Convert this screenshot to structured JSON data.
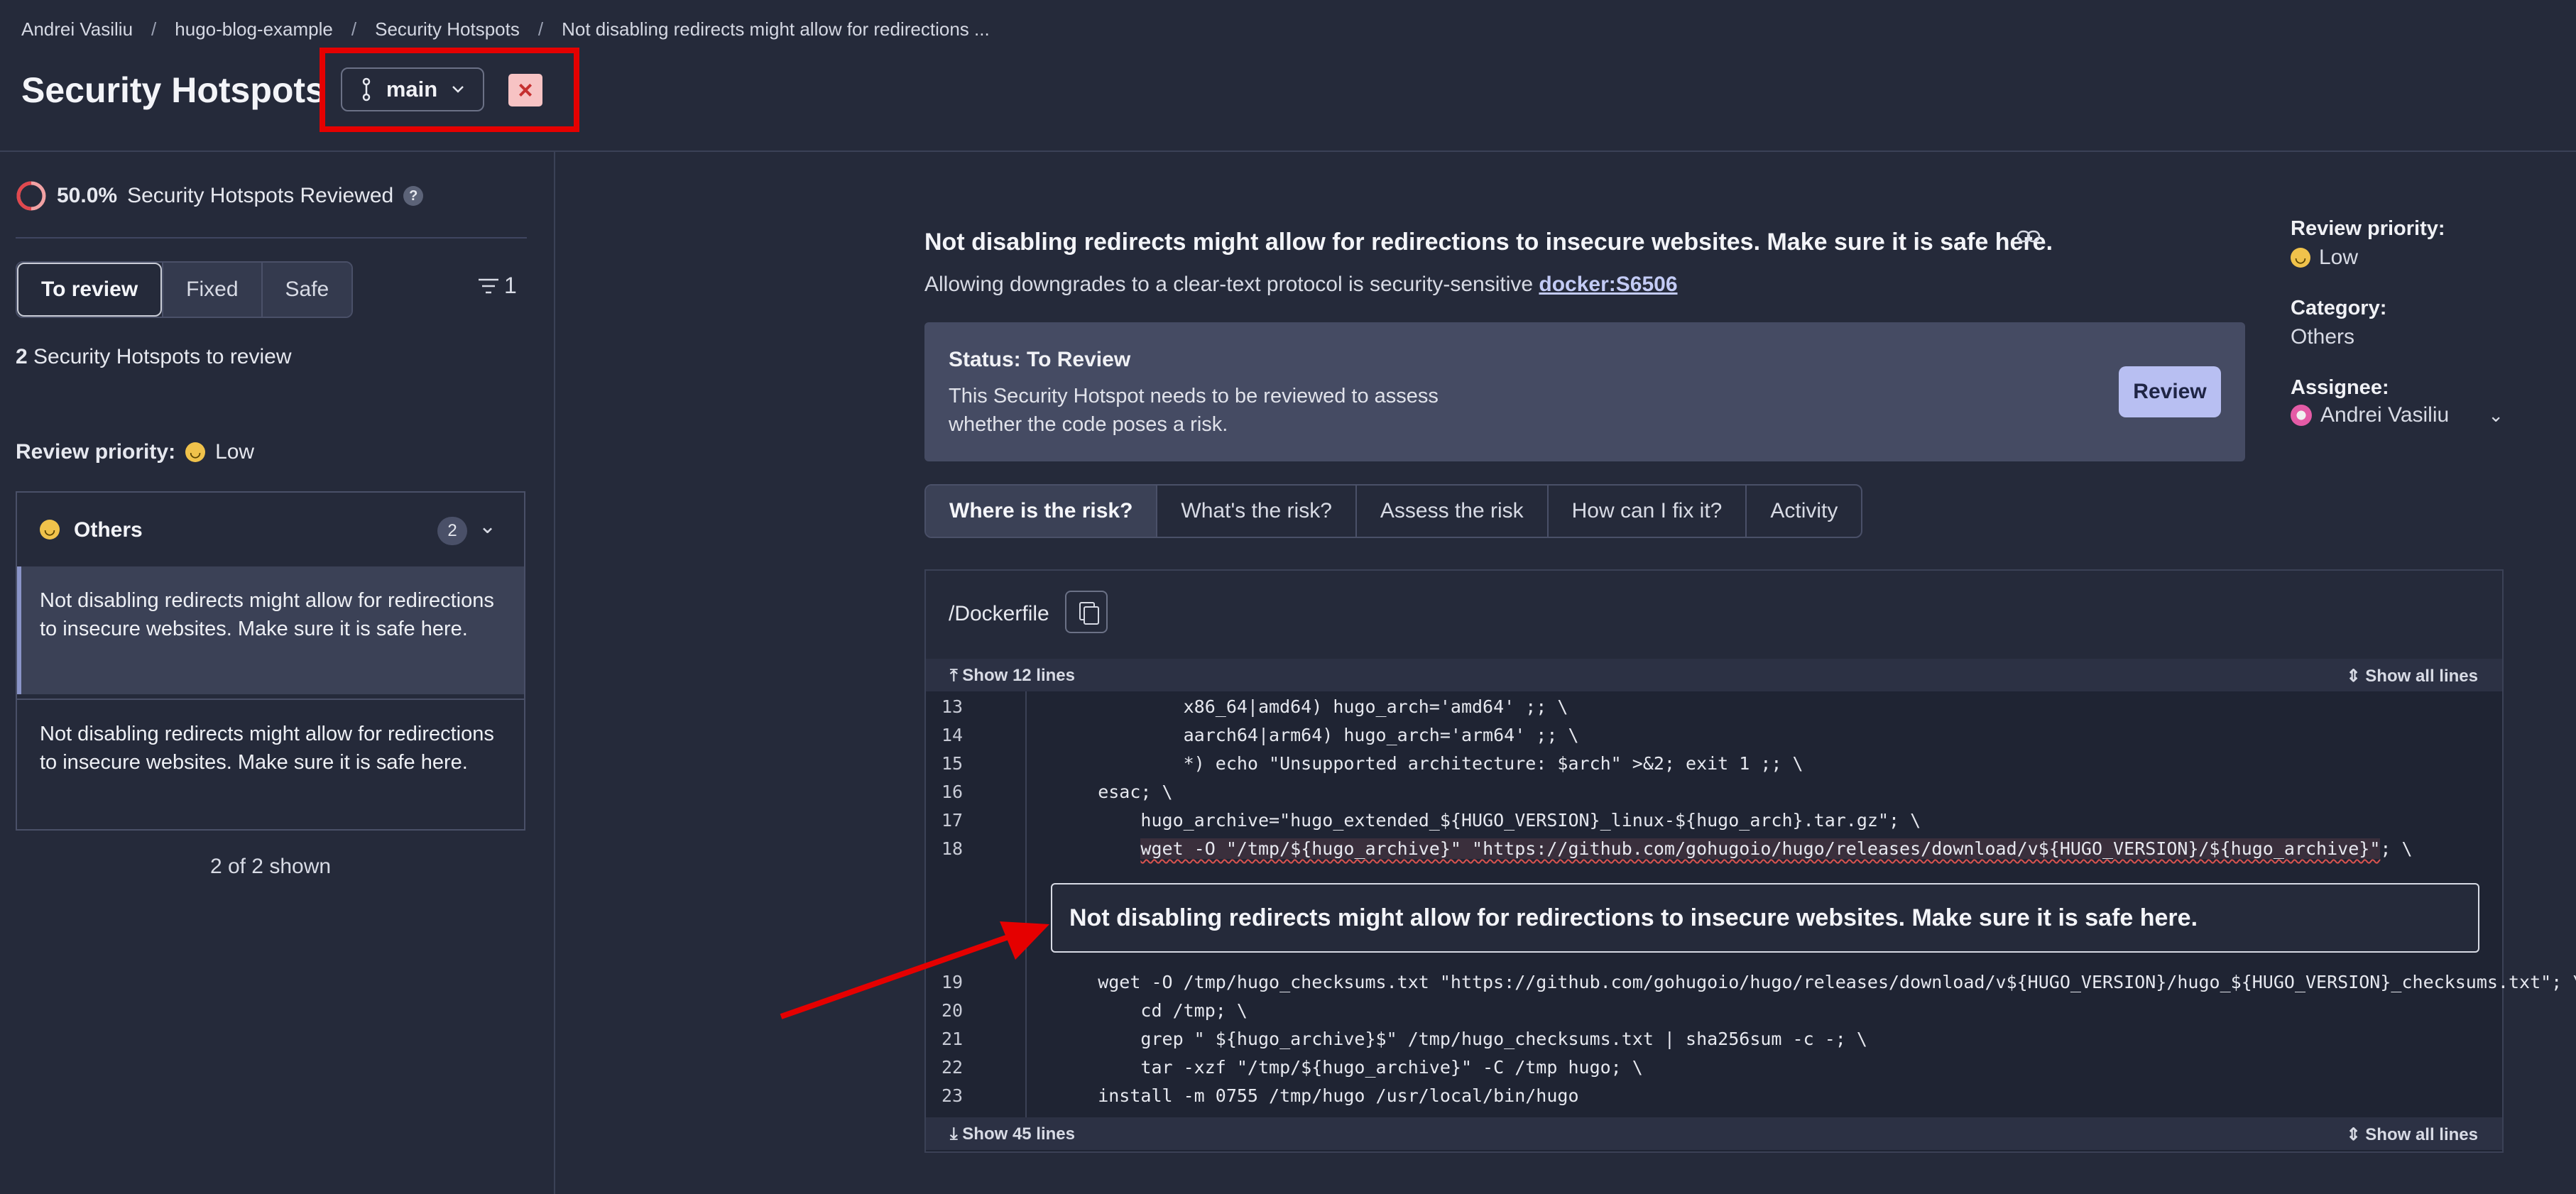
{
  "breadcrumb": {
    "items": [
      "Andrei Vasiliu",
      "hugo-blog-example",
      "Security Hotspots",
      "Not disabling redirects might allow for redirections ..."
    ],
    "separator": "/"
  },
  "header": {
    "title": "Security Hotspots",
    "branch": "main",
    "close_symbol": "×"
  },
  "sidebar": {
    "progress_percent": "50.0%",
    "progress_fraction": 0.5,
    "progress_label": "Security Hotspots Reviewed",
    "help_symbol": "?",
    "tabs": [
      "To review",
      "Fixed",
      "Safe"
    ],
    "filter_count": "1",
    "hotspot_count": "2",
    "hotspot_count_label": "Security Hotspots to review",
    "review_priority_label": "Review priority:",
    "review_priority_value": "Low",
    "category": {
      "name": "Others",
      "count": "2",
      "items": [
        "Not disabling redirects might allow for redirections to insecure websites. Make sure it is safe here.",
        "Not disabling redirects might allow for redirections to insecure websites. Make sure it is safe here."
      ]
    },
    "shown_label": "2 of 2 shown"
  },
  "main": {
    "title": "Not disabling redirects might allow for redirections to insecure websites. Make sure it is safe here.",
    "subtitle_text": "Allowing downgrades to a clear-text protocol is security-sensitive",
    "rule_key": "docker:S6506",
    "status": {
      "title": "Status: To Review",
      "text": "This Security Hotspot needs to be reviewed to assess whether the code poses a risk.",
      "review_button": "Review"
    },
    "tabs": [
      "Where is the risk?",
      "What's the risk?",
      "Assess the risk",
      "How can I fix it?",
      "Activity"
    ],
    "code": {
      "file": "/Dockerfile",
      "show_above": "Show 12 lines",
      "show_below": "Show 45 lines",
      "show_all": "Show all lines",
      "lines_before": [
        {
          "n": "13",
          "text": "            x86_64|amd64) hugo_arch='amd64' ;; \\"
        },
        {
          "n": "14",
          "text": "            aarch64|arm64) hugo_arch='arm64' ;; \\"
        },
        {
          "n": "15",
          "text": "            *) echo \"Unsupported architecture: $arch\" >&2; exit 1 ;; \\"
        },
        {
          "n": "16",
          "text": "    esac; \\"
        },
        {
          "n": "17",
          "text": "        hugo_archive=\"hugo_extended_${HUGO_VERSION}_linux-${hugo_arch}.tar.gz\"; \\"
        }
      ],
      "flagged_line": {
        "n": "18",
        "indent": "        ",
        "text": "wget -O \"/tmp/${hugo_archive}\" \"https://github.com/gohugoio/hugo/releases/download/v${HUGO_VERSION}/${hugo_archive}\"",
        "suffix": "; \\"
      },
      "issue_message": "Not disabling redirects might allow for redirections to insecure websites. Make sure it is safe here.",
      "lines_after": [
        {
          "n": "19",
          "text": "    wget -O /tmp/hugo_checksums.txt \"https://github.com/gohugoio/hugo/releases/download/v${HUGO_VERSION}/hugo_${HUGO_VERSION}_checksums.txt\"; \\"
        },
        {
          "n": "20",
          "text": "        cd /tmp; \\"
        },
        {
          "n": "21",
          "text": "        grep \" ${hugo_archive}$\" /tmp/hugo_checksums.txt | sha256sum -c -; \\"
        },
        {
          "n": "22",
          "text": "        tar -xzf \"/tmp/${hugo_archive}\" -C /tmp hugo; \\"
        },
        {
          "n": "23",
          "text": "    install -m 0755 /tmp/hugo /usr/local/bin/hugo"
        }
      ]
    }
  },
  "right_panel": {
    "review_priority_label": "Review priority:",
    "review_priority_value": "Low",
    "category_label": "Category:",
    "category_value": "Others",
    "assignee_label": "Assignee:",
    "assignee_value": "Andrei Vasiliu"
  },
  "colors": {
    "annotation_red": "#e50000",
    "accent": "#b8bff2",
    "background": "#252a3a"
  }
}
